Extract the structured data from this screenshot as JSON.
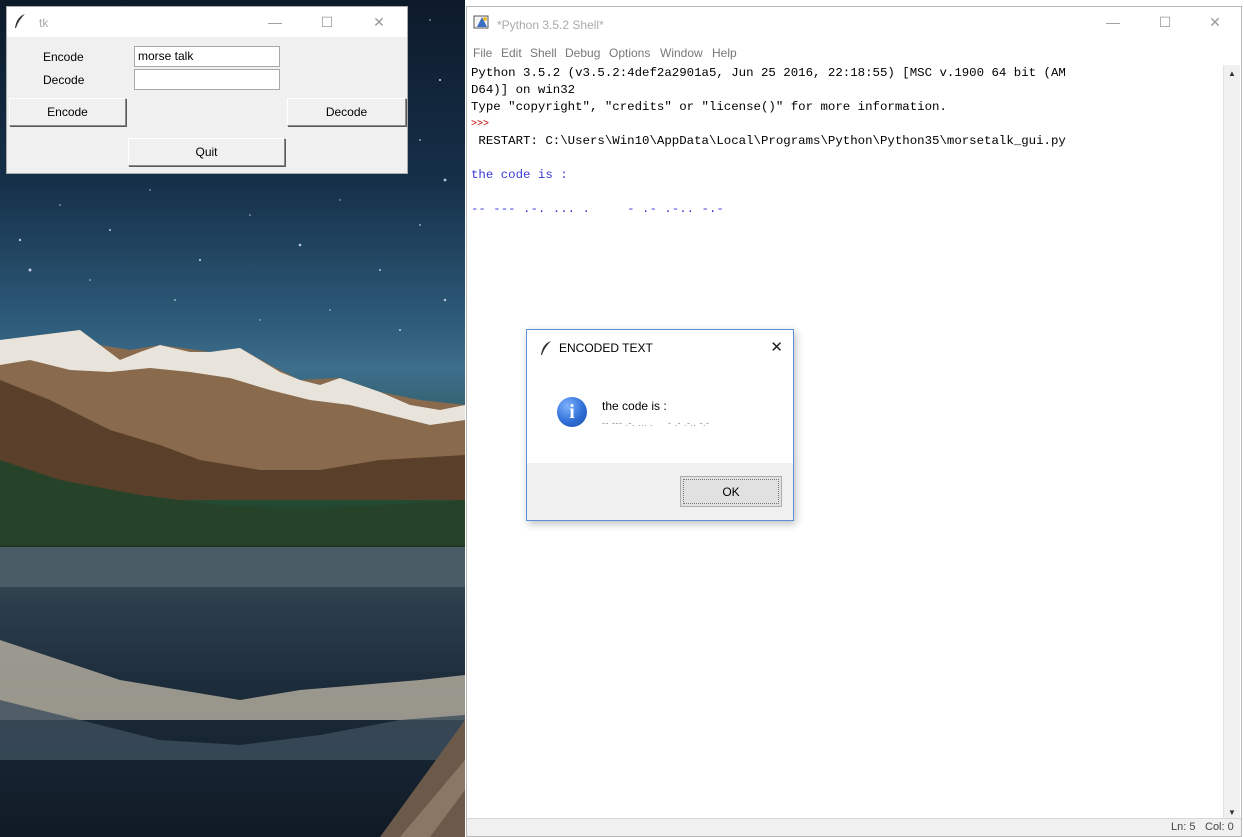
{
  "tk_window": {
    "title": "tk",
    "encode_label": "Encode",
    "decode_label": "Decode",
    "encode_input_value": "morse talk",
    "decode_input_value": "",
    "encode_button": "Encode",
    "decode_button": "Decode",
    "quit_button": "Quit"
  },
  "shell_window": {
    "title": "*Python 3.5.2 Shell*",
    "menu": [
      "File",
      "Edit",
      "Shell",
      "Debug",
      "Options",
      "Window",
      "Help"
    ],
    "lines": {
      "l1": "Python 3.5.2 (v3.5.2:4def2a2901a5, Jun 25 2016, 22:18:55) [MSC v.1900 64 bit (AM",
      "l2": "D64)] on win32",
      "l3": "Type \"copyright\", \"credits\" or \"license()\" for more information.",
      "prompt": ">>>",
      "l5": " RESTART: C:\\Users\\Win10\\AppData\\Local\\Programs\\Python\\Python35\\morsetalk_gui.py",
      "l6": "the code is :",
      "l7": "-- --- .-. ... .     - .- .-.. -.-"
    },
    "status": {
      "ln": "Ln: 5",
      "col": "Col: 0"
    }
  },
  "message_box": {
    "title": "ENCODED TEXT",
    "close": "✕",
    "text": "the code is :",
    "morse": "-- --- .-. ... .     - .- .-.. -.-",
    "ok_button": "OK",
    "icon": "info-icon"
  },
  "window_controls": {
    "minimize": "—",
    "maximize": "☐",
    "close": "✕"
  }
}
